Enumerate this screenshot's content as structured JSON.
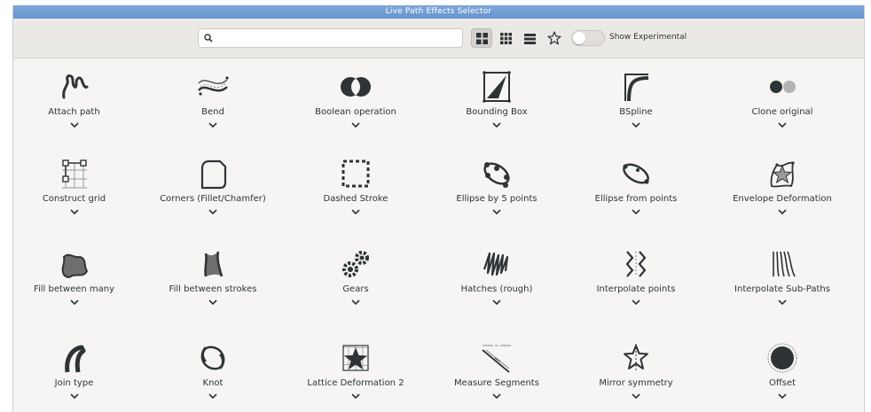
{
  "window": {
    "title": "Live Path Effects Selector"
  },
  "toolbar": {
    "search": {
      "value": "",
      "placeholder": ""
    },
    "view_buttons": [
      {
        "icon": "large-grid-icon",
        "active": true
      },
      {
        "icon": "small-grid-icon",
        "active": false
      },
      {
        "icon": "list-icon",
        "active": false
      },
      {
        "icon": "star-icon",
        "active": false
      }
    ],
    "experimental_toggle": {
      "label": "Show Experimental",
      "on": false
    }
  },
  "effects": [
    {
      "label": "Attach path",
      "icon": "attach-path-icon"
    },
    {
      "label": "Bend",
      "icon": "bend-icon"
    },
    {
      "label": "Boolean operation",
      "icon": "boolean-operation-icon"
    },
    {
      "label": "Bounding Box",
      "icon": "bounding-box-icon"
    },
    {
      "label": "BSpline",
      "icon": "bspline-icon"
    },
    {
      "label": "Clone original",
      "icon": "clone-original-icon"
    },
    {
      "label": "Construct grid",
      "icon": "construct-grid-icon"
    },
    {
      "label": "Corners (Fillet/Chamfer)",
      "icon": "corners-icon"
    },
    {
      "label": "Dashed Stroke",
      "icon": "dashed-stroke-icon"
    },
    {
      "label": "Ellipse by 5 points",
      "icon": "ellipse-5-points-icon"
    },
    {
      "label": "Ellipse from points",
      "icon": "ellipse-from-points-icon"
    },
    {
      "label": "Envelope Deformation",
      "icon": "envelope-deformation-icon"
    },
    {
      "label": "Fill between many",
      "icon": "fill-between-many-icon"
    },
    {
      "label": "Fill between strokes",
      "icon": "fill-between-strokes-icon"
    },
    {
      "label": "Gears",
      "icon": "gears-icon"
    },
    {
      "label": "Hatches (rough)",
      "icon": "hatches-icon"
    },
    {
      "label": "Interpolate points",
      "icon": "interpolate-points-icon"
    },
    {
      "label": "Interpolate Sub-Paths",
      "icon": "interpolate-subpaths-icon"
    },
    {
      "label": "Join type",
      "icon": "join-type-icon"
    },
    {
      "label": "Knot",
      "icon": "knot-icon"
    },
    {
      "label": "Lattice Deformation 2",
      "icon": "lattice-deformation-icon"
    },
    {
      "label": "Measure Segments",
      "icon": "measure-segments-icon"
    },
    {
      "label": "Mirror symmetry",
      "icon": "mirror-symmetry-icon"
    },
    {
      "label": "Offset",
      "icon": "offset-icon"
    }
  ]
}
